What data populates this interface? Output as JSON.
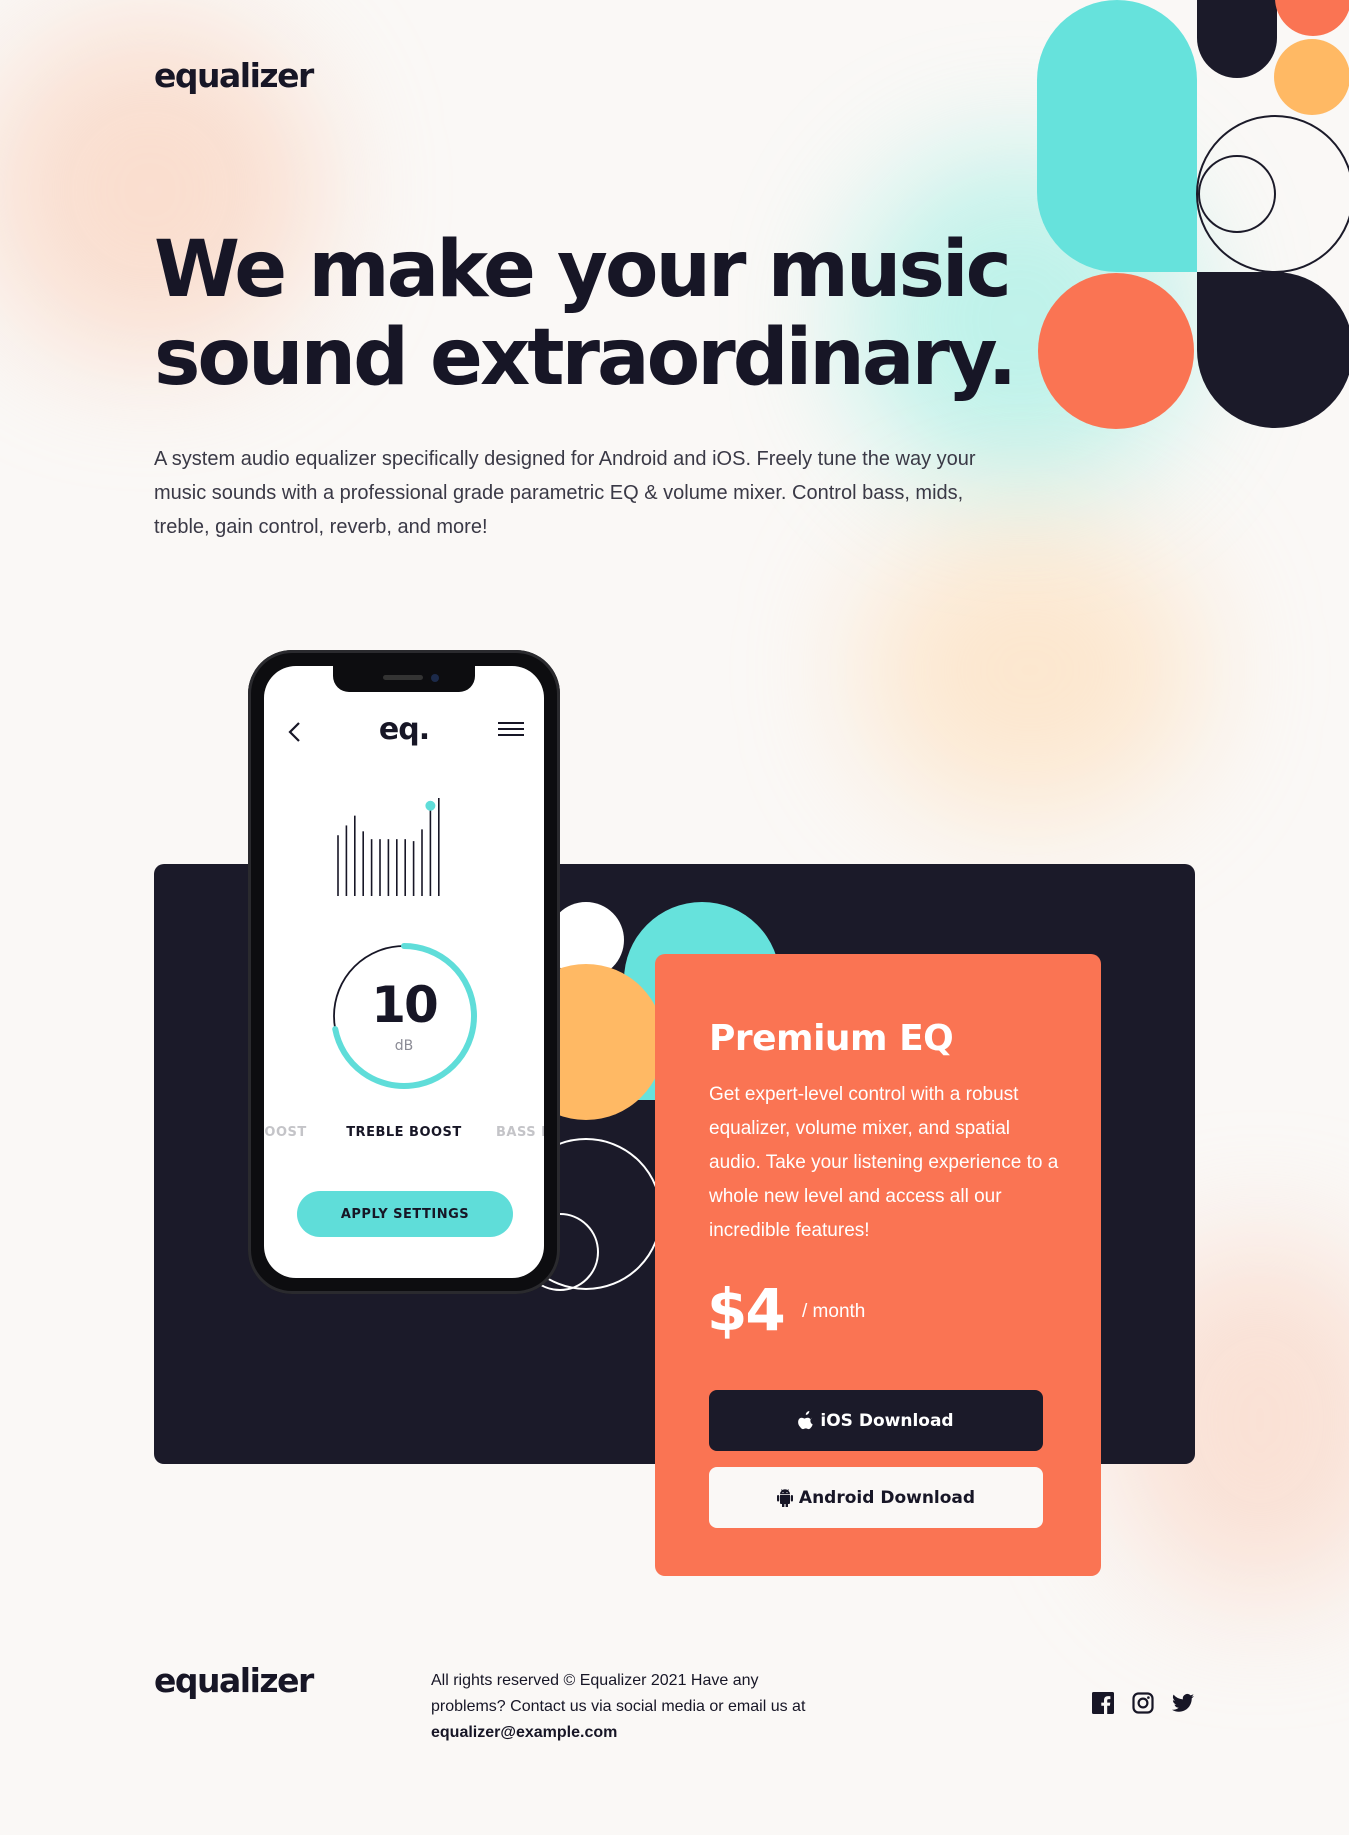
{
  "header": {
    "logo": "equalizer"
  },
  "hero": {
    "title": "We make your music sound extraordinary.",
    "description": "A system audio equalizer specifically designed for Android and iOS. Freely tune the way your music sounds with a professional grade parametric EQ & volume mixer. Control bass, mids, treble, gain control, reverb, and more!"
  },
  "phone": {
    "app_logo": "eq.",
    "eq_levels": [
      0.62,
      0.72,
      0.82,
      0.66,
      0.58,
      0.58,
      0.58,
      0.58,
      0.58,
      0.56,
      0.68,
      0.88,
      1.0
    ],
    "dial_value": "10",
    "dial_unit": "dB",
    "dial_fill_fraction": 0.72,
    "modes": {
      "prev": "BOOST",
      "active": "TREBLE BOOST",
      "next": "BASS B"
    },
    "apply_label": "APPLY SETTINGS"
  },
  "premium": {
    "title": "Premium EQ",
    "description": "Get expert-level control with a robust equalizer, volume mixer, and spatial audio. Take your listening experience to a whole new level and access all our incredible features!",
    "price": "$4",
    "period": "/ month",
    "ios_label": "iOS Download",
    "android_label": "Android Download"
  },
  "footer": {
    "logo": "equalizer",
    "text": "All rights reserved © Equalizer 2021 Have any problems? Contact us via social media or email us at ",
    "email": "equalizer@example.com",
    "socials": [
      "facebook-icon",
      "instagram-icon",
      "twitter-icon"
    ]
  },
  "colors": {
    "dark": "#1B1A29",
    "coral": "#FA7453",
    "aqua": "#66E2DC",
    "amber": "#FFB964",
    "background": "#FAF8F6"
  }
}
